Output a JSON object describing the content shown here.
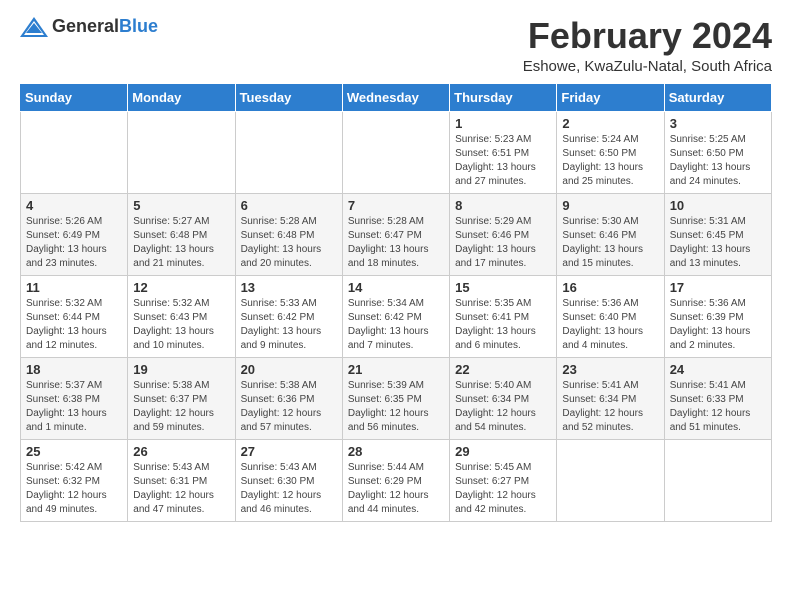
{
  "header": {
    "logo_general": "General",
    "logo_blue": "Blue",
    "title": "February 2024",
    "subtitle": "Eshowe, KwaZulu-Natal, South Africa"
  },
  "days_of_week": [
    "Sunday",
    "Monday",
    "Tuesday",
    "Wednesday",
    "Thursday",
    "Friday",
    "Saturday"
  ],
  "weeks": [
    [
      {
        "day": "",
        "info": ""
      },
      {
        "day": "",
        "info": ""
      },
      {
        "day": "",
        "info": ""
      },
      {
        "day": "",
        "info": ""
      },
      {
        "day": "1",
        "info": "Sunrise: 5:23 AM\nSunset: 6:51 PM\nDaylight: 13 hours\nand 27 minutes."
      },
      {
        "day": "2",
        "info": "Sunrise: 5:24 AM\nSunset: 6:50 PM\nDaylight: 13 hours\nand 25 minutes."
      },
      {
        "day": "3",
        "info": "Sunrise: 5:25 AM\nSunset: 6:50 PM\nDaylight: 13 hours\nand 24 minutes."
      }
    ],
    [
      {
        "day": "4",
        "info": "Sunrise: 5:26 AM\nSunset: 6:49 PM\nDaylight: 13 hours\nand 23 minutes."
      },
      {
        "day": "5",
        "info": "Sunrise: 5:27 AM\nSunset: 6:48 PM\nDaylight: 13 hours\nand 21 minutes."
      },
      {
        "day": "6",
        "info": "Sunrise: 5:28 AM\nSunset: 6:48 PM\nDaylight: 13 hours\nand 20 minutes."
      },
      {
        "day": "7",
        "info": "Sunrise: 5:28 AM\nSunset: 6:47 PM\nDaylight: 13 hours\nand 18 minutes."
      },
      {
        "day": "8",
        "info": "Sunrise: 5:29 AM\nSunset: 6:46 PM\nDaylight: 13 hours\nand 17 minutes."
      },
      {
        "day": "9",
        "info": "Sunrise: 5:30 AM\nSunset: 6:46 PM\nDaylight: 13 hours\nand 15 minutes."
      },
      {
        "day": "10",
        "info": "Sunrise: 5:31 AM\nSunset: 6:45 PM\nDaylight: 13 hours\nand 13 minutes."
      }
    ],
    [
      {
        "day": "11",
        "info": "Sunrise: 5:32 AM\nSunset: 6:44 PM\nDaylight: 13 hours\nand 12 minutes."
      },
      {
        "day": "12",
        "info": "Sunrise: 5:32 AM\nSunset: 6:43 PM\nDaylight: 13 hours\nand 10 minutes."
      },
      {
        "day": "13",
        "info": "Sunrise: 5:33 AM\nSunset: 6:42 PM\nDaylight: 13 hours\nand 9 minutes."
      },
      {
        "day": "14",
        "info": "Sunrise: 5:34 AM\nSunset: 6:42 PM\nDaylight: 13 hours\nand 7 minutes."
      },
      {
        "day": "15",
        "info": "Sunrise: 5:35 AM\nSunset: 6:41 PM\nDaylight: 13 hours\nand 6 minutes."
      },
      {
        "day": "16",
        "info": "Sunrise: 5:36 AM\nSunset: 6:40 PM\nDaylight: 13 hours\nand 4 minutes."
      },
      {
        "day": "17",
        "info": "Sunrise: 5:36 AM\nSunset: 6:39 PM\nDaylight: 13 hours\nand 2 minutes."
      }
    ],
    [
      {
        "day": "18",
        "info": "Sunrise: 5:37 AM\nSunset: 6:38 PM\nDaylight: 13 hours\nand 1 minute."
      },
      {
        "day": "19",
        "info": "Sunrise: 5:38 AM\nSunset: 6:37 PM\nDaylight: 12 hours\nand 59 minutes."
      },
      {
        "day": "20",
        "info": "Sunrise: 5:38 AM\nSunset: 6:36 PM\nDaylight: 12 hours\nand 57 minutes."
      },
      {
        "day": "21",
        "info": "Sunrise: 5:39 AM\nSunset: 6:35 PM\nDaylight: 12 hours\nand 56 minutes."
      },
      {
        "day": "22",
        "info": "Sunrise: 5:40 AM\nSunset: 6:34 PM\nDaylight: 12 hours\nand 54 minutes."
      },
      {
        "day": "23",
        "info": "Sunrise: 5:41 AM\nSunset: 6:34 PM\nDaylight: 12 hours\nand 52 minutes."
      },
      {
        "day": "24",
        "info": "Sunrise: 5:41 AM\nSunset: 6:33 PM\nDaylight: 12 hours\nand 51 minutes."
      }
    ],
    [
      {
        "day": "25",
        "info": "Sunrise: 5:42 AM\nSunset: 6:32 PM\nDaylight: 12 hours\nand 49 minutes."
      },
      {
        "day": "26",
        "info": "Sunrise: 5:43 AM\nSunset: 6:31 PM\nDaylight: 12 hours\nand 47 minutes."
      },
      {
        "day": "27",
        "info": "Sunrise: 5:43 AM\nSunset: 6:30 PM\nDaylight: 12 hours\nand 46 minutes."
      },
      {
        "day": "28",
        "info": "Sunrise: 5:44 AM\nSunset: 6:29 PM\nDaylight: 12 hours\nand 44 minutes."
      },
      {
        "day": "29",
        "info": "Sunrise: 5:45 AM\nSunset: 6:27 PM\nDaylight: 12 hours\nand 42 minutes."
      },
      {
        "day": "",
        "info": ""
      },
      {
        "day": "",
        "info": ""
      }
    ]
  ]
}
